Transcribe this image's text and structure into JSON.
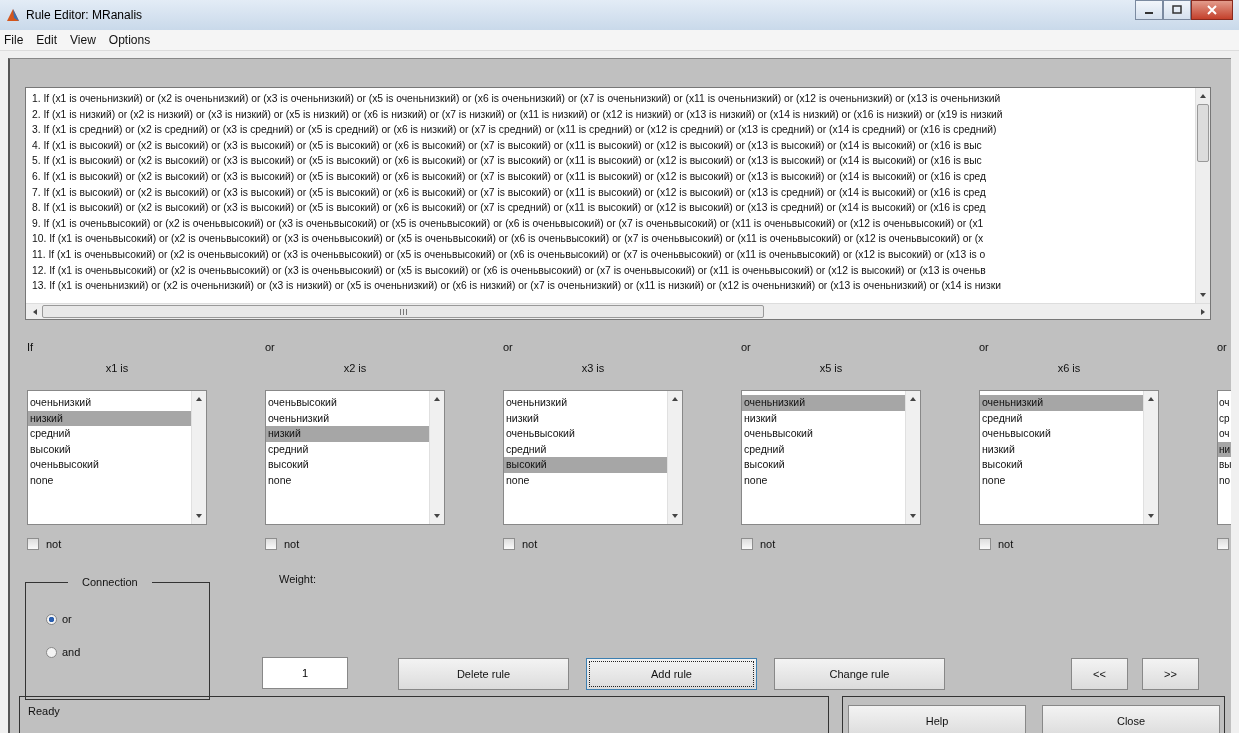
{
  "window": {
    "title": "Rule Editor: MRanalis"
  },
  "menu": [
    "File",
    "Edit",
    "View",
    "Options"
  ],
  "rules": [
    "1. If (x1 is оченьнизкий) or (x2 is оченьнизкий) or (x3 is оченьнизкий) or (x5 is оченьнизкий) or (x6 is оченьнизкий) or (x7 is оченьнизкий) or (x11 is оченьнизкий) or (x12 is оченьнизкий) or (x13 is оченьнизкий",
    "2. If (x1 is низкий) or (x2 is низкий) or (x3 is низкий) or (x5 is низкий) or (x6 is низкий) or (x7 is низкий) or (x11 is низкий) or (x12 is низкий) or (x13 is низкий) or (x14 is низкий) or (x16 is низкий) or (x19 is низкий",
    "3. If (x1 is средний) or (x2 is средний) or (x3 is средний) or (x5 is средний) or (x6 is низкий) or (x7 is средний) or (x11 is средний) or (x12 is средний) or (x13 is средний) or (x14 is средний) or (x16 is средний)",
    "4. If (x1 is высокий) or (x2 is высокий) or (x3 is высокий) or (x5 is высокий) or (x6 is высокий) or (x7 is высокий) or (x11 is высокий) or (x12 is высокий) or (x13 is высокий) or (x14 is высокий) or (x16 is выс",
    "5. If (x1 is высокий) or (x2 is высокий) or (x3 is высокий) or (x5 is высокий) or (x6 is высокий) or (x7 is высокий) or (x11 is высокий) or (x12 is высокий) or (x13 is высокий) or (x14 is высокий) or (x16 is выс",
    "6. If (x1 is высокий) or (x2 is высокий) or (x3 is высокий) or (x5 is высокий) or (x6 is высокий) or (x7 is высокий) or (x11 is высокий) or (x12 is высокий) or (x13 is высокий) or (x14 is высокий) or (x16 is сред",
    "7. If (x1 is высокий) or (x2 is высокий) or (x3 is высокий) or (x5 is высокий) or (x6 is высокий) or (x7 is высокий) or (x11 is высокий) or (x12 is высокий) or (x13 is средний) or (x14 is высокий) or (x16 is сред",
    "8. If (x1 is высокий) or (x2 is высокий) or (x3 is высокий) or (x5 is высокий) or (x6 is высокий) or (x7 is средний) or (x11 is высокий) or (x12 is высокий) or (x13 is средний) or (x14 is высокий) or (x16 is сред",
    "9. If (x1 is оченьвысокий) or (x2 is оченьвысокий) or (x3 is оченьвысокий) or (x5 is оченьвысокий) or (x6 is оченьвысокий) or (x7 is оченьвысокий) or (x11 is оченьвысокий) or (x12 is оченьвысокий) or (x1",
    "10. If (x1 is оченьвысокий) or (x2 is оченьвысокий) or (x3 is оченьвысокий) or (x5 is оченьвысокий) or (x6 is оченьвысокий) or (x7 is оченьвысокий) or (x11 is оченьвысокий) or (x12 is оченьвысокий) or (x",
    "11. If (x1 is оченьвысокий) or (x2 is оченьвысокий) or (x3 is оченьвысокий) or (x5 is оченьвысокий) or (x6 is оченьвысокий) or (x7 is оченьвысокий) or (x11 is оченьвысокий) or (x12 is высокий) or (x13 is о",
    "12. If (x1 is оченьвысокий) or (x2 is оченьвысокий) or (x3 is оченьвысокий) or (x5 is высокий) or (x6 is оченьвысокий) or (x7 is оченьвысокий) or (x11 is оченьвысокий) or (x12 is высокий) or (x13 is оченьв",
    "13. If (x1 is оченьнизкий) or (x2 is оченьнизкий) or (x3 is низкий) or (x5 is оченьнизкий) or (x6 is низкий) or (x7 is оченьнизкий) or (x11 is низкий) or (x12 is оченьнизкий) or (x13 is оченьнизкий) or (x14 is низки"
  ],
  "antecedents": [
    {
      "connector": "If",
      "label": "x1 is",
      "options": [
        {
          "text": "оченьнизкий",
          "selected": false
        },
        {
          "text": "низкий",
          "selected": true
        },
        {
          "text": "средний",
          "selected": false
        },
        {
          "text": "высокий",
          "selected": false
        },
        {
          "text": "оченьвысокий",
          "selected": false
        },
        {
          "text": "none",
          "selected": false
        }
      ],
      "not": {
        "label": "not",
        "checked": false
      }
    },
    {
      "connector": "or",
      "label": "x2 is",
      "options": [
        {
          "text": "оченьвысокий",
          "selected": false
        },
        {
          "text": "оченьнизкий",
          "selected": false
        },
        {
          "text": "низкий",
          "selected": true
        },
        {
          "text": "средний",
          "selected": false
        },
        {
          "text": "высокий",
          "selected": false
        },
        {
          "text": "none",
          "selected": false
        }
      ],
      "not": {
        "label": "not",
        "checked": false
      }
    },
    {
      "connector": "or",
      "label": "x3 is",
      "options": [
        {
          "text": "оченьнизкий",
          "selected": false
        },
        {
          "text": "низкий",
          "selected": false
        },
        {
          "text": "оченьвысокий",
          "selected": false
        },
        {
          "text": "средний",
          "selected": false
        },
        {
          "text": "высокий",
          "selected": true
        },
        {
          "text": "none",
          "selected": false
        }
      ],
      "not": {
        "label": "not",
        "checked": false
      }
    },
    {
      "connector": "or",
      "label": "x5 is",
      "options": [
        {
          "text": "оченьнизкий",
          "selected": true
        },
        {
          "text": "низкий",
          "selected": false
        },
        {
          "text": "оченьвысокий",
          "selected": false
        },
        {
          "text": "средний",
          "selected": false
        },
        {
          "text": "высокий",
          "selected": false
        },
        {
          "text": "none",
          "selected": false
        }
      ],
      "not": {
        "label": "not",
        "checked": false
      }
    },
    {
      "connector": "or",
      "label": "x6 is",
      "options": [
        {
          "text": "оченьнизкий",
          "selected": true
        },
        {
          "text": "средний",
          "selected": false
        },
        {
          "text": "оченьвысокий",
          "selected": false
        },
        {
          "text": "низкий",
          "selected": false
        },
        {
          "text": "высокий",
          "selected": false
        },
        {
          "text": "none",
          "selected": false
        }
      ],
      "not": {
        "label": "not",
        "checked": false
      }
    },
    {
      "connector": "or",
      "options": [
        {
          "text": "оч",
          "selected": false
        },
        {
          "text": "ср",
          "selected": false
        },
        {
          "text": "оч",
          "selected": false
        },
        {
          "text": "ни",
          "selected": true
        },
        {
          "text": "вы",
          "selected": false
        },
        {
          "text": "no",
          "selected": false
        }
      ],
      "not": {
        "checked": false
      }
    }
  ],
  "connection": {
    "title": "Connection",
    "options": [
      {
        "label": "or",
        "selected": true
      },
      {
        "label": "and",
        "selected": false
      }
    ]
  },
  "weight": {
    "label": "Weight:",
    "value": "1"
  },
  "buttons": [
    {
      "label": "Delete rule",
      "focused": false
    },
    {
      "label": "Add rule",
      "focused": true
    },
    {
      "label": "Change rule",
      "focused": false
    }
  ],
  "nav_buttons": [
    "<<",
    ">>"
  ],
  "status": "Ready",
  "footer_buttons": [
    "Help",
    "Close"
  ]
}
